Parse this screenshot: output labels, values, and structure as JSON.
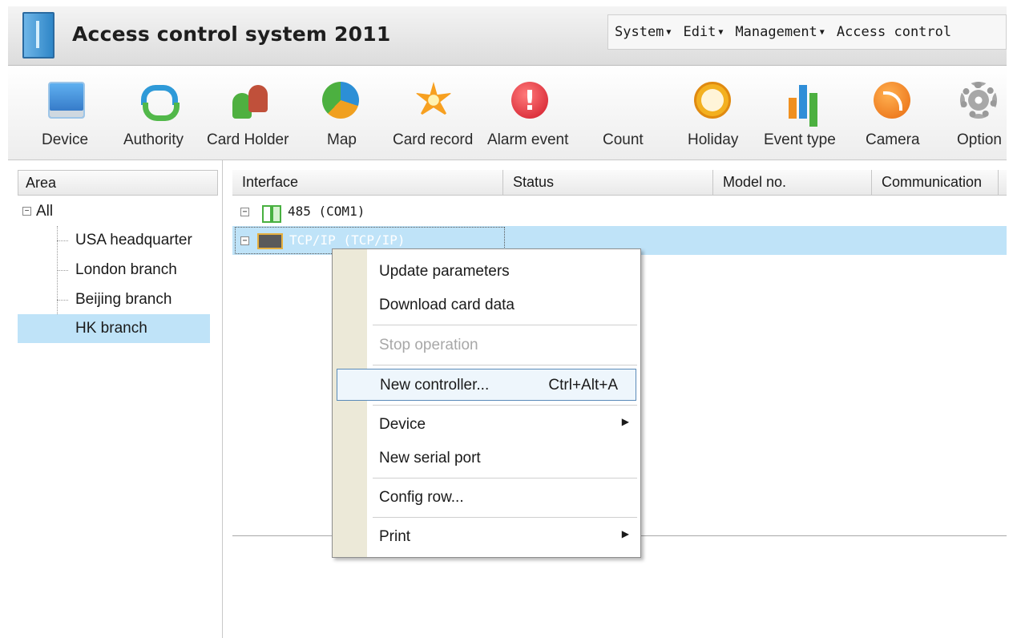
{
  "window": {
    "title": "Access control system 2011"
  },
  "menubar": {
    "items": [
      "System",
      "Edit",
      "Management",
      "Access control"
    ],
    "caret": "▼"
  },
  "toolbar": {
    "items": [
      {
        "label": "Device",
        "icon": "device-icon"
      },
      {
        "label": "Authority",
        "icon": "authority-icon"
      },
      {
        "label": "Card Holder",
        "icon": "card-holder-icon"
      },
      {
        "label": "Map",
        "icon": "map-icon"
      },
      {
        "label": "Card record",
        "icon": "card-record-icon"
      },
      {
        "label": "Alarm event",
        "icon": "alarm-event-icon"
      },
      {
        "label": "Count",
        "icon": null
      },
      {
        "label": "Holiday",
        "icon": "holiday-icon"
      },
      {
        "label": "Event type",
        "icon": "event-type-icon"
      },
      {
        "label": "Camera",
        "icon": "camera-icon"
      },
      {
        "label": "Option",
        "icon": "option-icon"
      }
    ]
  },
  "area_panel": {
    "header": "Area",
    "root": {
      "label": "All",
      "expander": "−"
    },
    "children": [
      "USA headquarter",
      "London branch",
      "Beijing branch",
      "HK branch"
    ],
    "selected": "HK branch"
  },
  "grid": {
    "columns": [
      "Interface",
      "Status",
      "Model no.",
      "Communication"
    ],
    "rows": [
      {
        "label": "485 (COM1)",
        "expander": "−"
      },
      {
        "label": "TCP/IP (TCP/IP)",
        "expander": "−"
      }
    ]
  },
  "context_menu": {
    "items": [
      {
        "label": "Update parameters"
      },
      {
        "label": "Download card data"
      },
      {
        "label": "Stop operation"
      },
      {
        "label": "New controller...",
        "shortcut": "Ctrl+Alt+A"
      },
      {
        "label": "Device",
        "submenu_arrow": "▶"
      },
      {
        "label": "New serial port"
      },
      {
        "label": "Config row..."
      },
      {
        "label": "Print",
        "submenu_arrow": "▶"
      }
    ]
  },
  "colors": {
    "selection": "#bfe3f8",
    "menu_highlight_border": "#5a8ab8",
    "disabled_text": "#a8a8a8"
  }
}
